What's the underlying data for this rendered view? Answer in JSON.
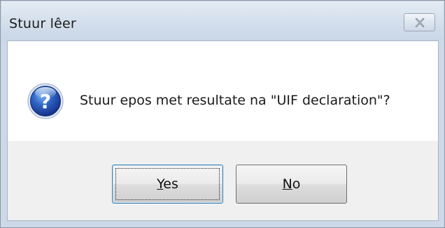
{
  "dialog": {
    "title": "Stuur lêer",
    "message": "Stuur epos met resultate na \"UIF declaration\"?",
    "icon": "question-icon",
    "close_icon": "close-icon"
  },
  "buttons": {
    "yes": {
      "accel": "Y",
      "rest": "es"
    },
    "no": {
      "accel": "N",
      "rest": "o"
    }
  },
  "colors": {
    "titlebar": "#d6e1ee",
    "client_bg": "#f0f0f0",
    "message_bg": "#ffffff",
    "default_button_border": "#3c7fb1",
    "icon_blue": "#1f4fa8"
  }
}
